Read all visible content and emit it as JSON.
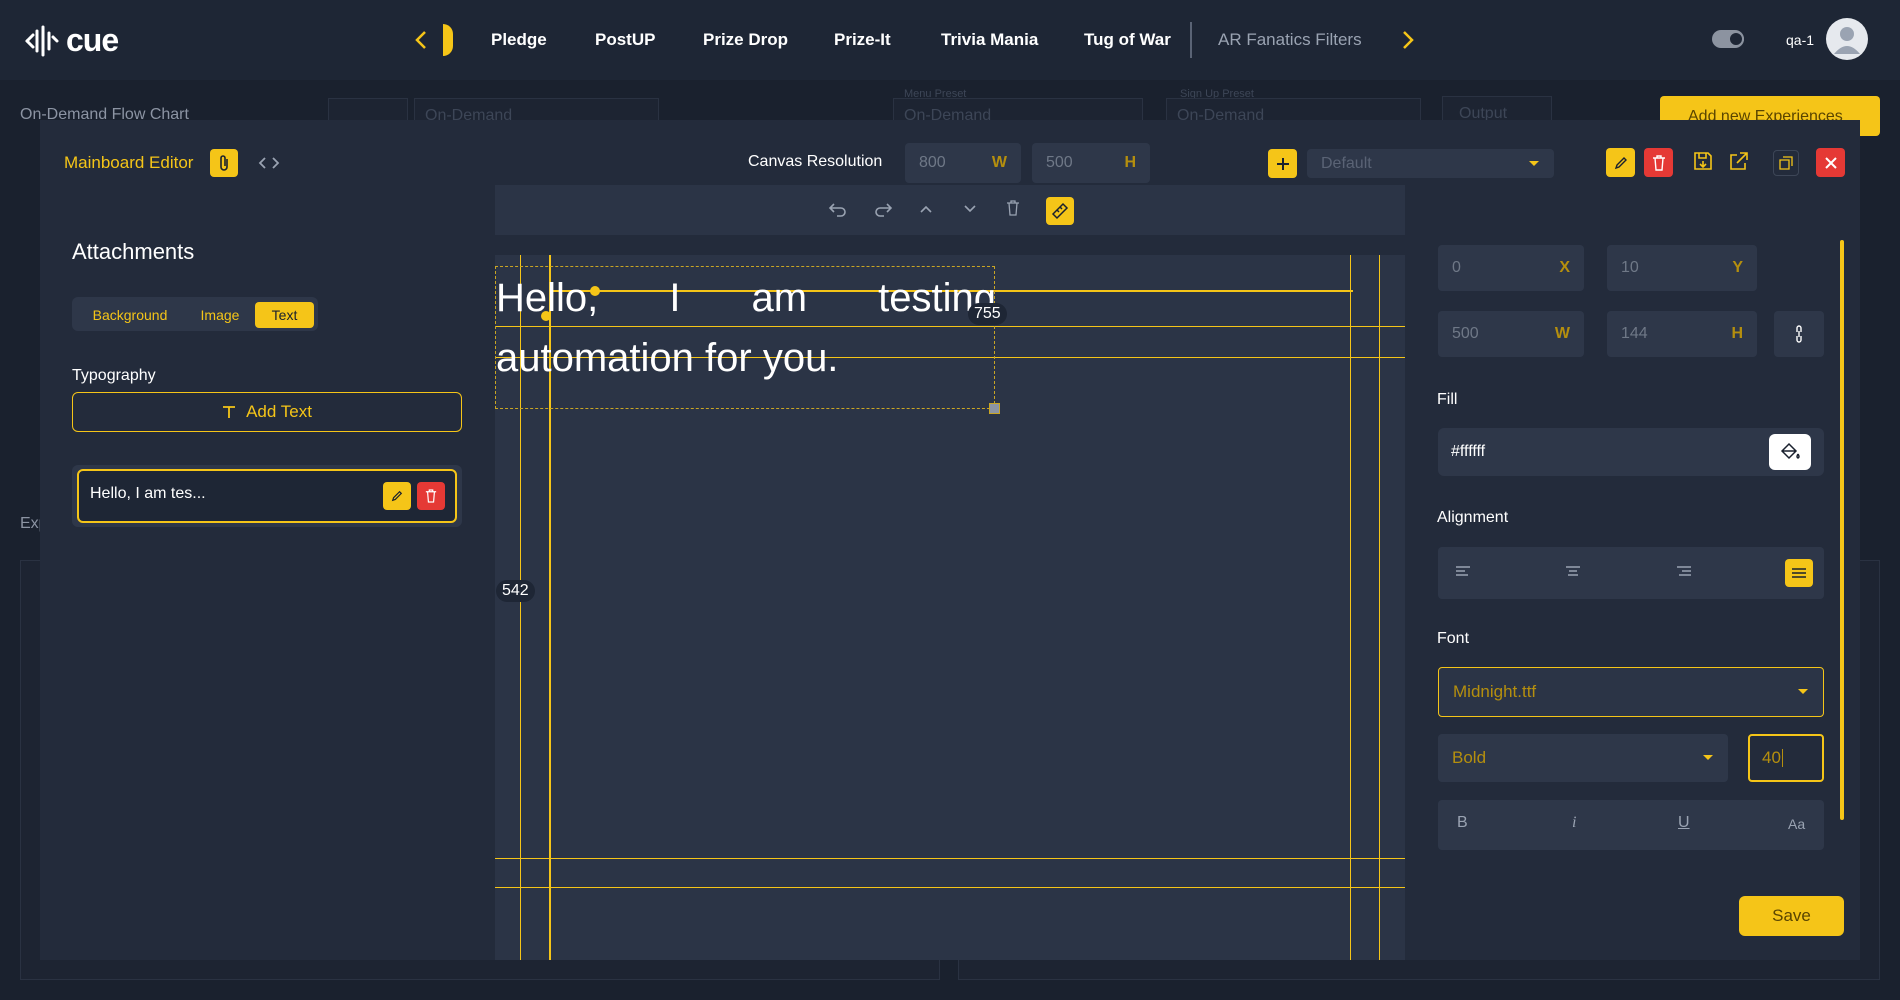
{
  "app": {
    "logo_text": "cue",
    "user": "qa-1"
  },
  "nav": {
    "items": [
      {
        "label": "Pledge"
      },
      {
        "label": "PostUP"
      },
      {
        "label": "Prize Drop"
      },
      {
        "label": "Prize-It"
      },
      {
        "label": "Trivia Mania"
      },
      {
        "label": "Tug of War"
      },
      {
        "label": "AR Fanatics Filters"
      }
    ]
  },
  "background_page": {
    "title": "On-Demand Flow Chart",
    "select_value": "On-Demand",
    "menu_preset_label": "Menu Preset",
    "menu_preset_value": "On-Demand",
    "signup_preset_label": "Sign Up Preset",
    "signup_preset_value": "On-Demand",
    "output_label": "Output",
    "add_button": "Add new Experiences",
    "side_text": "Exp"
  },
  "editor": {
    "title": "Mainboard Editor",
    "canvas_resolution_label": "Canvas Resolution",
    "width": "800",
    "height": "500",
    "width_unit": "W",
    "height_unit": "H",
    "preset": "Default"
  },
  "attachments": {
    "heading": "Attachments",
    "tabs": [
      {
        "label": "Background"
      },
      {
        "label": "Image"
      },
      {
        "label": "Text",
        "active": true
      }
    ],
    "typography_label": "Typography",
    "add_text_label": "Add Text",
    "items": [
      {
        "label": "Hello, I am tes..."
      }
    ]
  },
  "canvas": {
    "text": "Hello, I am testing automation for you.",
    "guide_x_label": "755",
    "guide_y_label": "542"
  },
  "properties": {
    "x": "0",
    "x_unit": "X",
    "y": "10",
    "y_unit": "Y",
    "w": "500",
    "w_unit": "W",
    "h": "144",
    "h_unit": "H",
    "fill_label": "Fill",
    "fill_value": "#ffffff",
    "alignment_label": "Alignment",
    "alignment_selected": "justify",
    "font_label": "Font",
    "font_value": "Midnight.ttf",
    "weight_value": "Bold",
    "size_value": "40",
    "style_buttons": [
      "B",
      "i",
      "U",
      "Aa"
    ],
    "save_label": "Save"
  },
  "colors": {
    "accent": "#f5c518",
    "danger": "#e53935",
    "background": "#1a212e",
    "panel": "#232b3b"
  }
}
